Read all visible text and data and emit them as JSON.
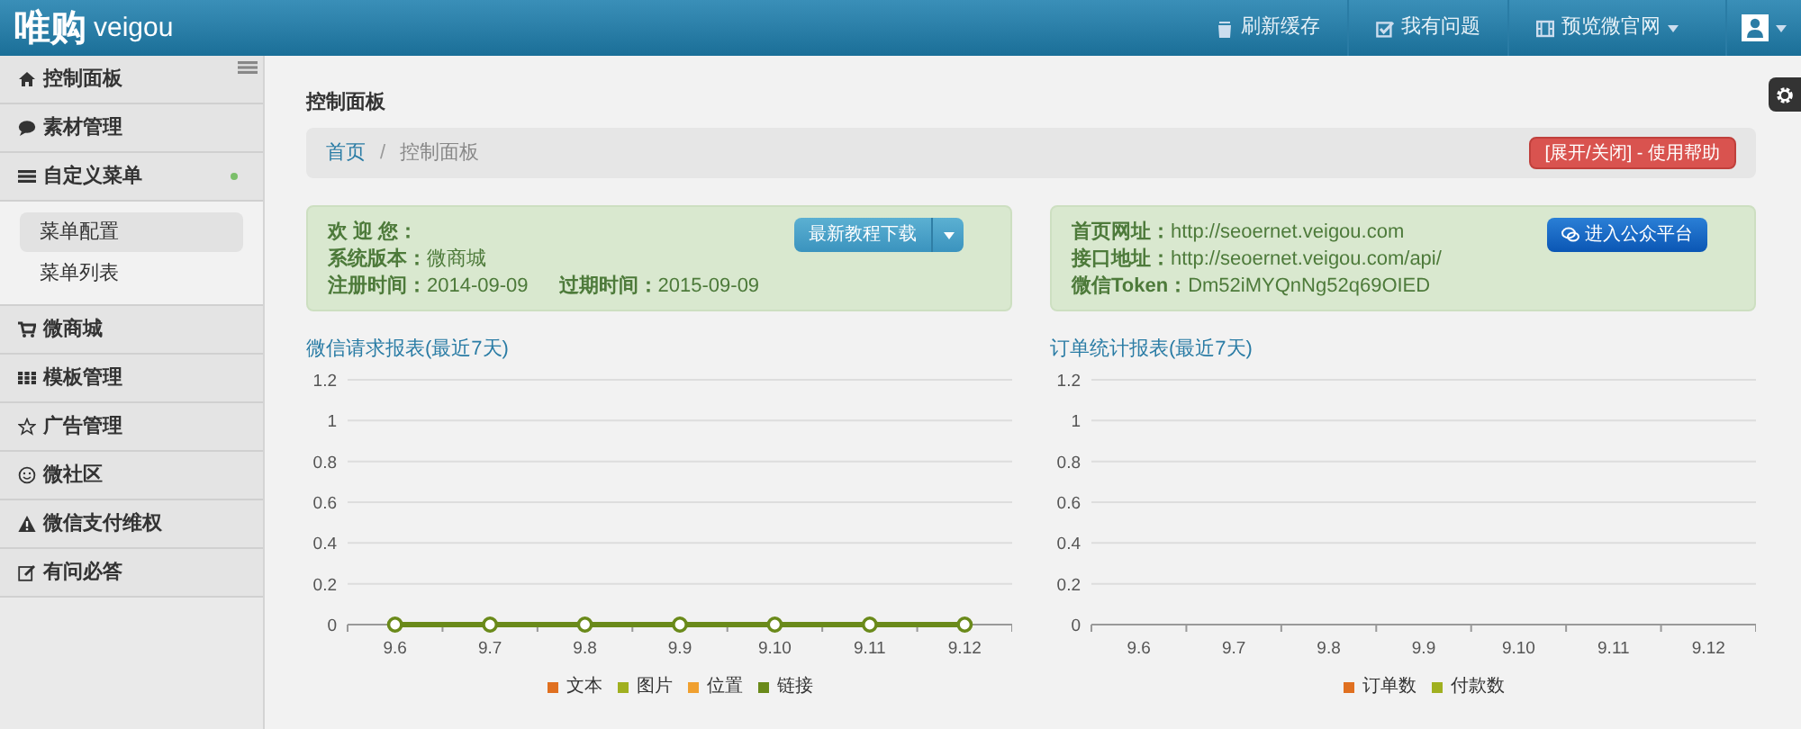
{
  "brand": {
    "logo": "唯购",
    "name": "veigou"
  },
  "topnav": [
    {
      "kind": "refresh",
      "label": "刷新缓存",
      "dropdown": false
    },
    {
      "kind": "question",
      "label": "我有问题",
      "dropdown": false
    },
    {
      "kind": "preview",
      "label": "预览微官网",
      "dropdown": true
    }
  ],
  "sidebar": {
    "items": [
      {
        "kind": "home",
        "label": "控制面板",
        "expanded": false
      },
      {
        "kind": "comment",
        "label": "素材管理",
        "expanded": false
      },
      {
        "kind": "list",
        "label": "自定义菜单",
        "expanded": true,
        "children": [
          {
            "label": "菜单配置",
            "selected": true
          },
          {
            "label": "菜单列表",
            "selected": false
          }
        ]
      },
      {
        "kind": "cart",
        "label": "微商城",
        "expanded": false
      },
      {
        "kind": "grid",
        "label": "模板管理",
        "expanded": false
      },
      {
        "kind": "star",
        "label": "广告管理",
        "expanded": false
      },
      {
        "kind": "smile",
        "label": "微社区",
        "expanded": false
      },
      {
        "kind": "warning",
        "label": "微信支付维权",
        "expanded": false
      },
      {
        "kind": "edit",
        "label": "有问必答",
        "expanded": false
      }
    ]
  },
  "page_title": "控制面板",
  "breadcrumb": {
    "separator": "/",
    "items": [
      {
        "label": "首页",
        "link": true
      },
      {
        "label": "控制面板",
        "link": false
      }
    ]
  },
  "help_button": "[展开/关闭] - 使用帮助",
  "welcome": {
    "greeting": "欢 迎 您：",
    "lines": [
      {
        "label": "系统版本：",
        "value": "微商城"
      },
      {
        "label": "注册时间：",
        "value": "2014-09-09"
      },
      {
        "label": "过期时间：",
        "value": "2015-09-09"
      }
    ],
    "button": "最新教程下载"
  },
  "account": {
    "lines": [
      {
        "label": "首页网址：",
        "value": "http://seoernet.veigou.com"
      },
      {
        "label": "接口地址：",
        "value": "http://seoernet.veigou.com/api/"
      },
      {
        "label": "微信Token：",
        "value": "Dm52iMYQnNg52q69OIED"
      }
    ],
    "button": "进入公众平台"
  },
  "charts": [
    {
      "chart_data": {
        "type": "line",
        "grid": true,
        "legend": "bottom",
        "title": "微信请求报表(最近7天)",
        "categories": [
          "9.6",
          "9.7",
          "9.8",
          "9.9",
          "9.10",
          "9.11",
          "9.12"
        ],
        "ylim": [
          0,
          1.2
        ],
        "yticks": [
          0,
          0.2,
          0.4,
          0.6,
          0.8,
          1,
          1.2
        ],
        "series": [
          {
            "name": "文本",
            "color": "#e07020",
            "values": [
              null,
              null,
              null,
              null,
              null,
              null,
              null
            ]
          },
          {
            "name": "图片",
            "color": "#a0b020",
            "values": [
              null,
              null,
              null,
              null,
              null,
              null,
              null
            ]
          },
          {
            "name": "位置",
            "color": "#f0a030",
            "values": [
              null,
              null,
              null,
              null,
              null,
              null,
              null
            ]
          },
          {
            "name": "链接",
            "color": "#6a8a1a",
            "marker": "circle",
            "values": [
              0,
              0,
              0,
              0,
              0,
              0,
              0
            ]
          }
        ]
      }
    },
    {
      "chart_data": {
        "type": "line",
        "grid": true,
        "legend": "bottom",
        "title": "订单统计报表(最近7天)",
        "categories": [
          "9.6",
          "9.7",
          "9.8",
          "9.9",
          "9.10",
          "9.11",
          "9.12"
        ],
        "ylim": [
          0,
          1.2
        ],
        "yticks": [
          0,
          0.2,
          0.4,
          0.6,
          0.8,
          1,
          1.2
        ],
        "series": [
          {
            "name": "订单数",
            "color": "#e07020",
            "values": [
              null,
              null,
              null,
              null,
              null,
              null,
              null
            ]
          },
          {
            "name": "付款数",
            "color": "#a0b020",
            "values": [
              null,
              null,
              null,
              null,
              null,
              null,
              null
            ]
          }
        ]
      }
    }
  ]
}
